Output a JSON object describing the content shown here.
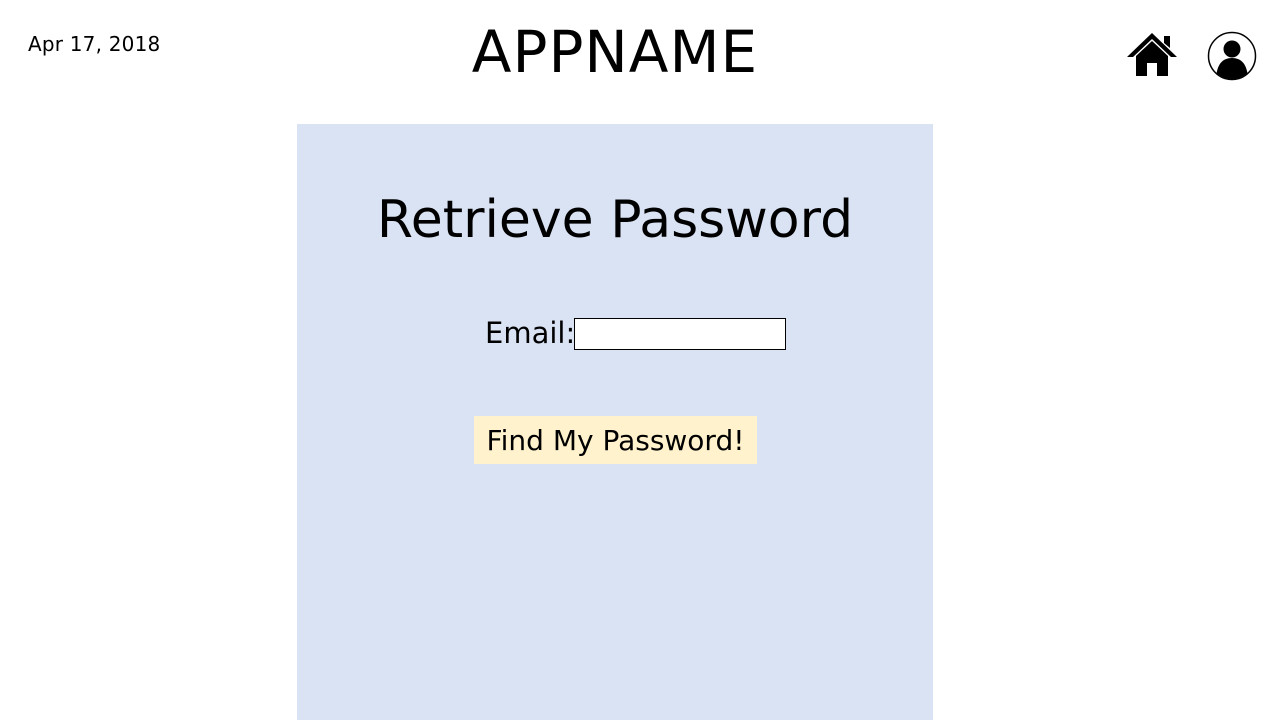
{
  "header": {
    "date": "Apr 17, 2018",
    "app_name": "APPNAME",
    "home_icon": "home-icon",
    "profile_icon": "user-profile-icon"
  },
  "retrieve_panel": {
    "title": "Retrieve Password",
    "email_label": "Email:",
    "email_value": "",
    "email_placeholder": "",
    "submit_label": "Find My Password!"
  },
  "colors": {
    "panel_background": "#dae3f3",
    "button_background": "#fff2cc",
    "page_background": "#ffffff"
  }
}
